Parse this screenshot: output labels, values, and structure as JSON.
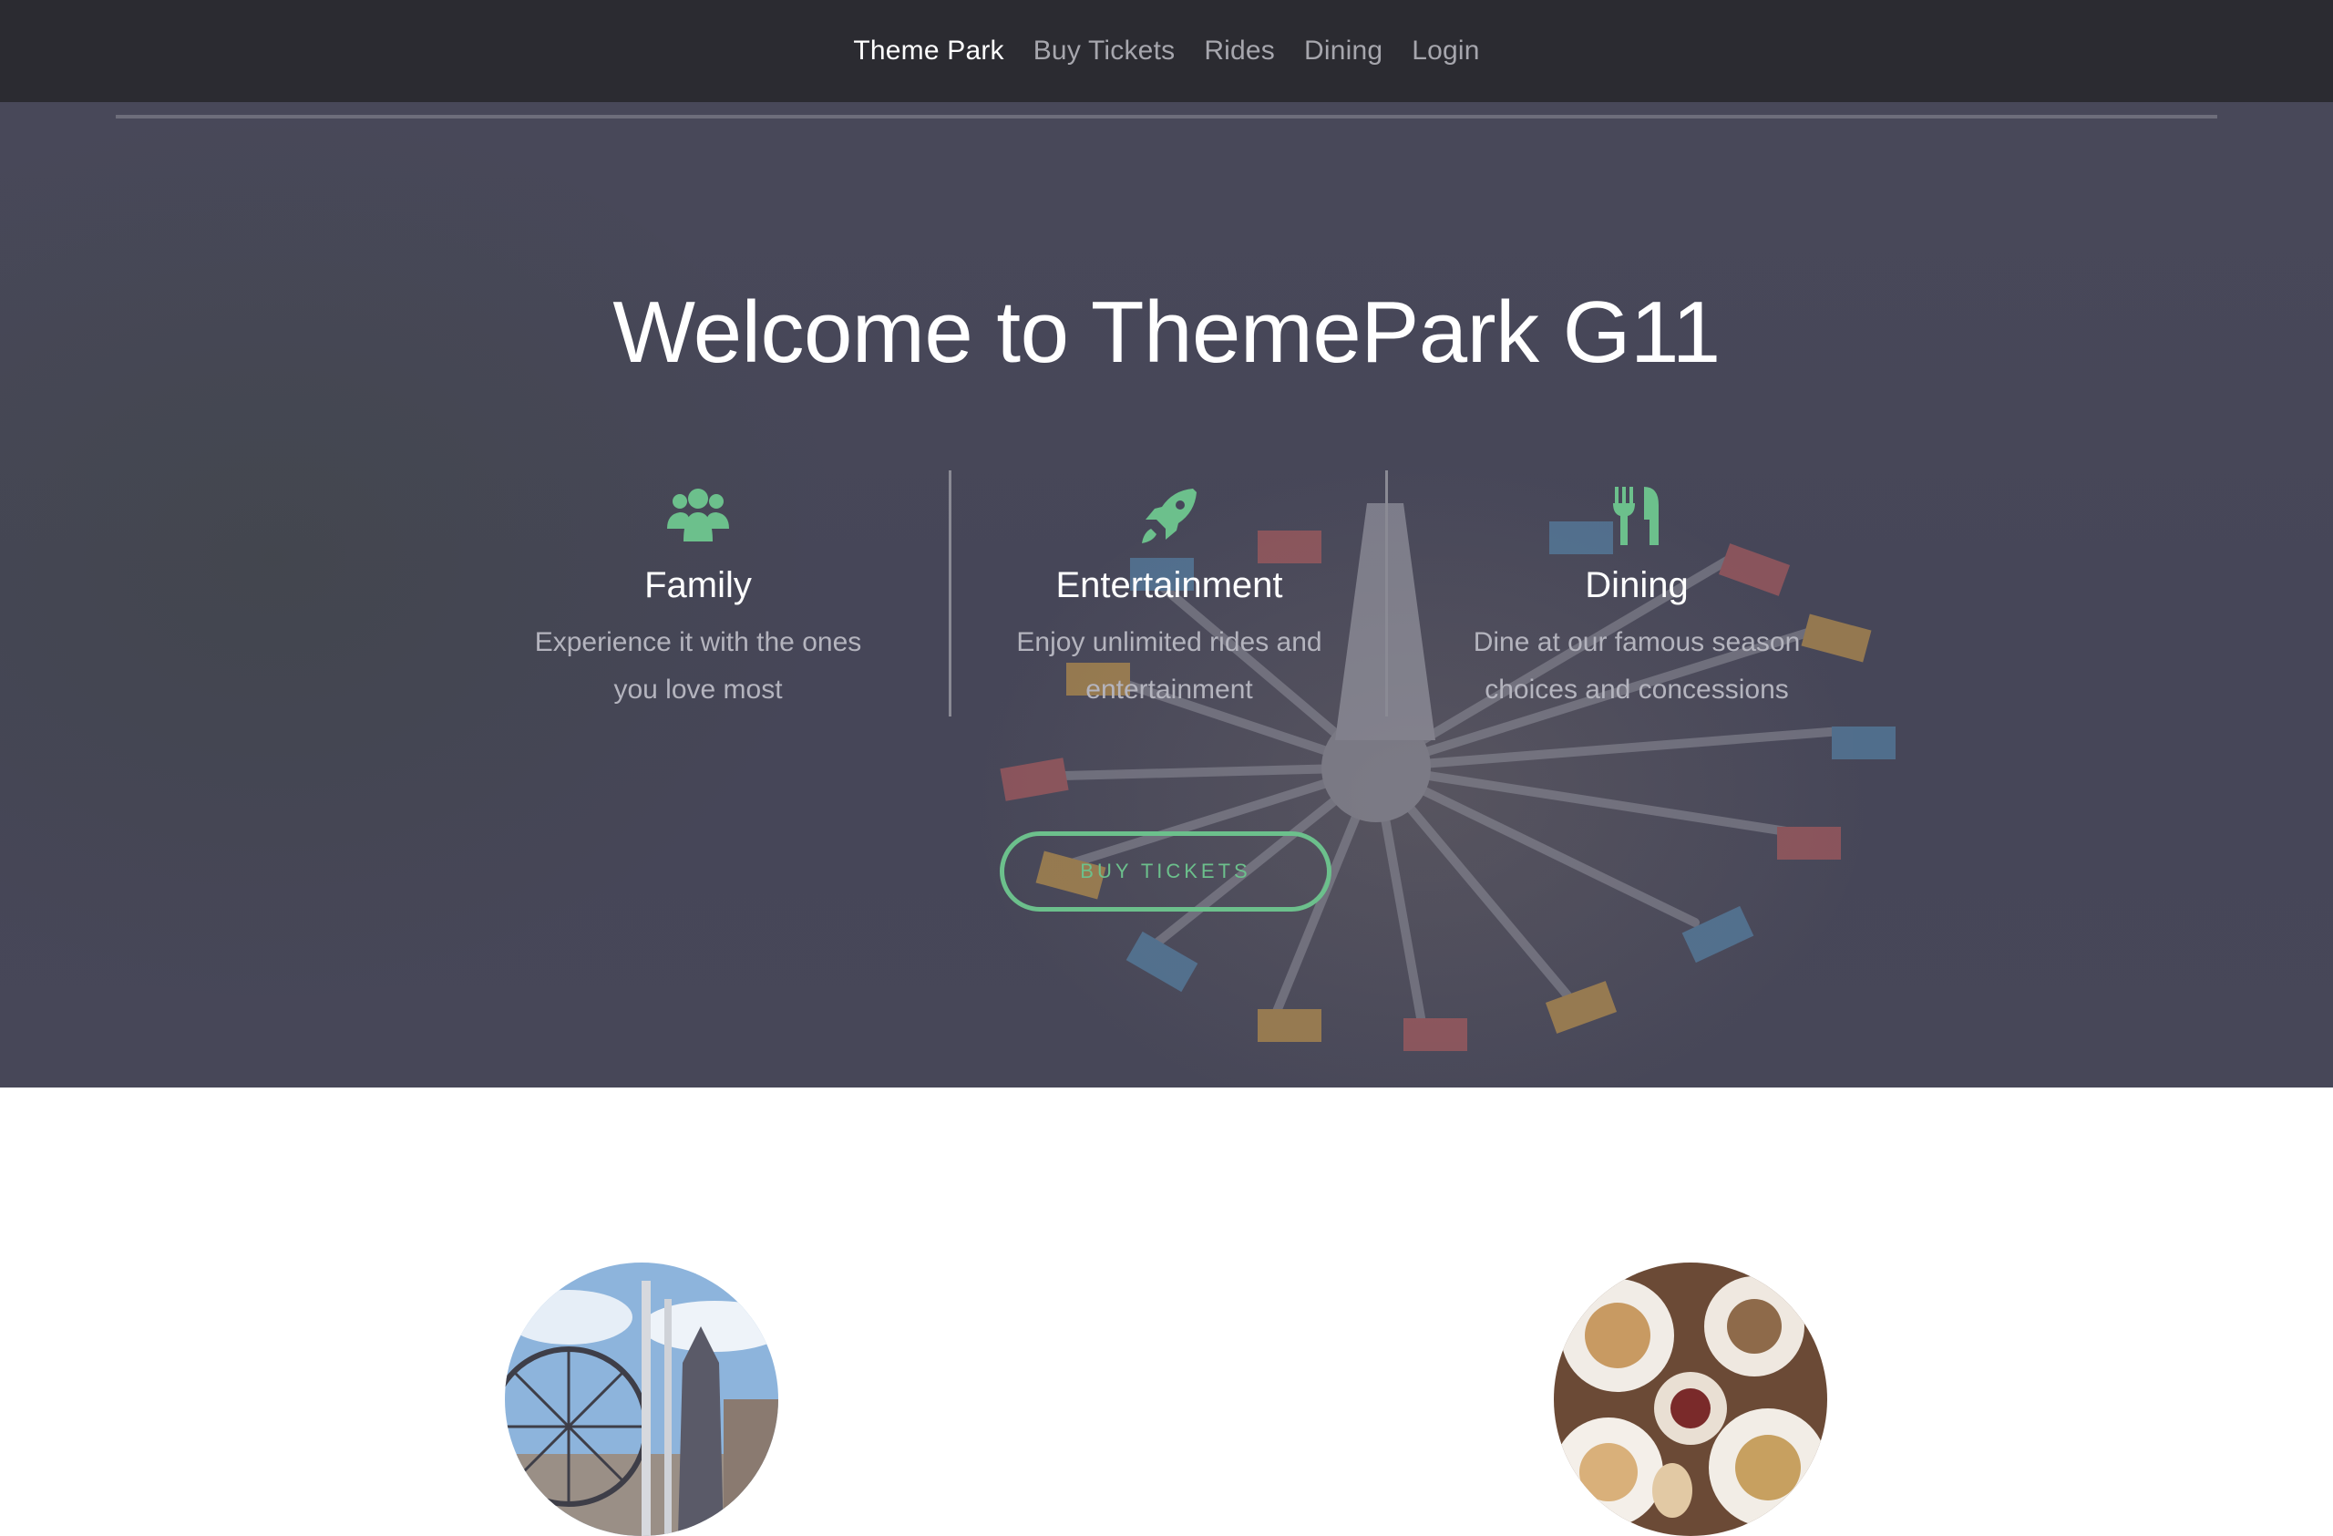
{
  "navbar": {
    "brand": "Theme Park",
    "links": [
      {
        "label": "Buy Tickets"
      },
      {
        "label": "Rides"
      },
      {
        "label": "Dining"
      },
      {
        "label": "Login"
      }
    ]
  },
  "hero": {
    "title": "Welcome to ThemePark G11",
    "features": [
      {
        "icon": "users-icon",
        "heading": "Family",
        "description": "Experience it with the ones you love most"
      },
      {
        "icon": "rocket-icon",
        "heading": "Entertainment",
        "description": "Enjoy unlimited rides and entertainment"
      },
      {
        "icon": "utensils-icon",
        "heading": "Dining",
        "description": "Dine at our famous season choices and concessions"
      }
    ],
    "cta_label": "BUY TICKETS"
  },
  "colors": {
    "accent": "#6cc08c",
    "navbar_bg": "#2b2b31",
    "hero_overlay": "#46465a"
  }
}
